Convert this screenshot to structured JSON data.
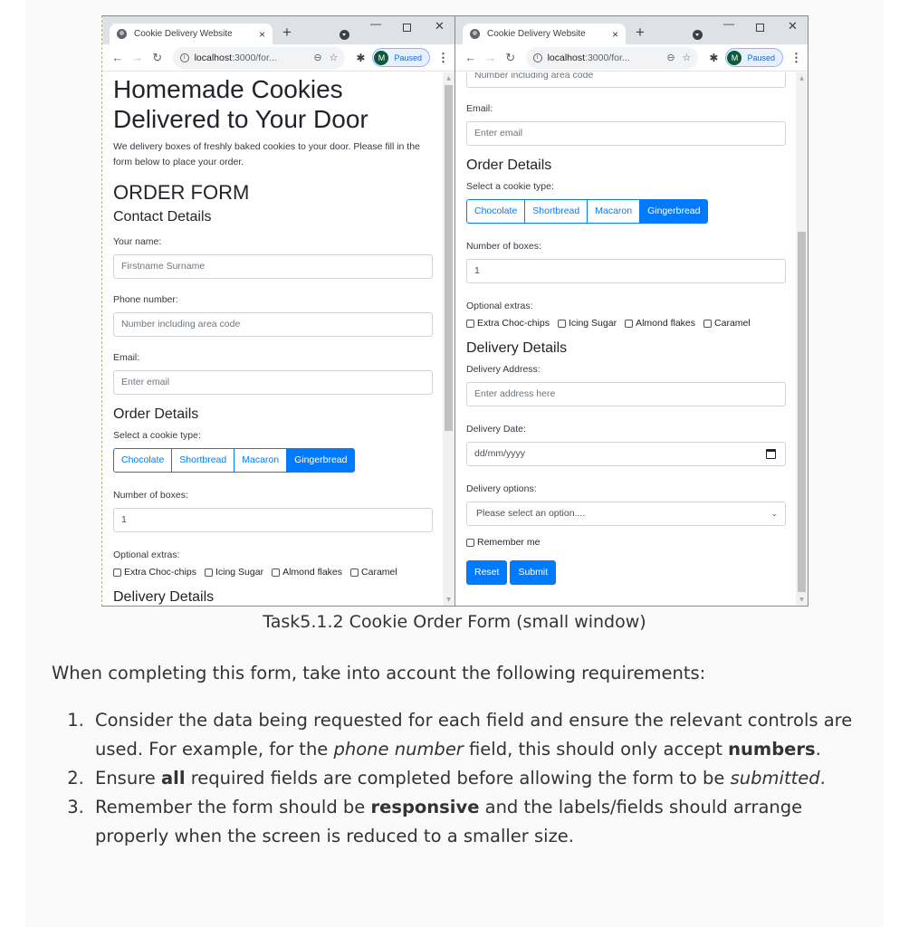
{
  "browser": {
    "tab_title": "Cookie Delivery Website",
    "tab_close": "×",
    "new_tab": "+",
    "url_host": "localhost",
    "url_rest": ":3000/for...",
    "profile_initial": "M",
    "profile_status": "Paused",
    "win_min": "—",
    "win_close": "✕"
  },
  "page": {
    "heading": "Homemade Cookies Delivered to Your Door",
    "lead": "We delivery boxes of freshly baked cookies to your door. Please fill in the form below to place your order.",
    "form_title": "ORDER FORM",
    "contact_heading": "Contact Details",
    "name_label": "Your name:",
    "name_placeholder": "Firstname Surname",
    "phone_label": "Phone number:",
    "phone_placeholder": "Number including area code",
    "email_label": "Email:",
    "email_placeholder": "Enter email",
    "order_heading": "Order Details",
    "cookie_label": "Select a cookie type:",
    "cookie_types": [
      "Chocolate",
      "Shortbread",
      "Macaron",
      "Gingerbread"
    ],
    "cookie_selected": "Gingerbread",
    "boxes_label": "Number of boxes:",
    "boxes_value": "1",
    "extras_label": "Optional extras:",
    "extras": [
      "Extra Choc-chips",
      "Icing Sugar",
      "Almond flakes",
      "Caramel"
    ],
    "delivery_heading": "Delivery Details",
    "address_label": "Delivery Address:",
    "address_placeholder": "Enter address here",
    "date_label": "Delivery Date:",
    "date_placeholder": "dd/mm/yyyy",
    "options_label": "Delivery options:",
    "options_selected": "Please select an option....",
    "remember_label": "Remember me",
    "reset_label": "Reset",
    "submit_label": "Submit"
  },
  "caption": "Task5.1.2 Cookie Order Form (small window)",
  "instructions": {
    "intro": "When completing this form, take into account the following requirements:",
    "items": [
      {
        "num": "1.",
        "parts": [
          "Consider the data being requested for each field and ensure the relevant controls are used. For example, for the ",
          "phone number",
          " field, this should only accept ",
          "numbers",
          "."
        ]
      },
      {
        "num": "2.",
        "parts": [
          "Ensure ",
          "all",
          " required fields are completed before allowing the form to be ",
          "submitted",
          "."
        ]
      },
      {
        "num": "3.",
        "parts": [
          "Remember the form should be ",
          "responsive",
          " and the labels/fields should arrange properly when the screen is reduced to a smaller size."
        ]
      }
    ]
  },
  "colors": {
    "primary": "#007bff",
    "tabbar": "#dee1e6",
    "text": "#212529"
  }
}
